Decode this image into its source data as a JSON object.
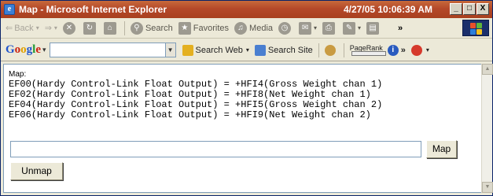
{
  "window": {
    "title": "Map - Microsoft Internet Explorer",
    "datetime": "4/27/05 10:06:39 AM",
    "controls": [
      "_",
      "□",
      "X"
    ]
  },
  "toolbar": {
    "back_label": "Back",
    "search_label": "Search",
    "favorites_label": "Favorites",
    "media_label": "Media"
  },
  "google_toolbar": {
    "logo": [
      "G",
      "o",
      "o",
      "g",
      "l",
      "e"
    ],
    "search_web_label": "Search Web",
    "search_site_label": "Search Site",
    "pagerank_label": "PageRank",
    "query_value": ""
  },
  "page": {
    "map_label": "Map:",
    "mappings": [
      "EF00(Hardy Control-Link Float Output) = +HFI4(Gross Weight chan 1)",
      "EF02(Hardy Control-Link Float Output) = +HFI8(Net Weight chan 1)",
      "EF04(Hardy Control-Link Float Output) = +HFI5(Gross Weight chan 2)",
      "EF06(Hardy Control-Link Float Output) = +HFI9(Net Weight chan 2)"
    ],
    "map_input_value": "",
    "map_button_label": "Map",
    "unmap_button_label": "Unmap"
  }
}
